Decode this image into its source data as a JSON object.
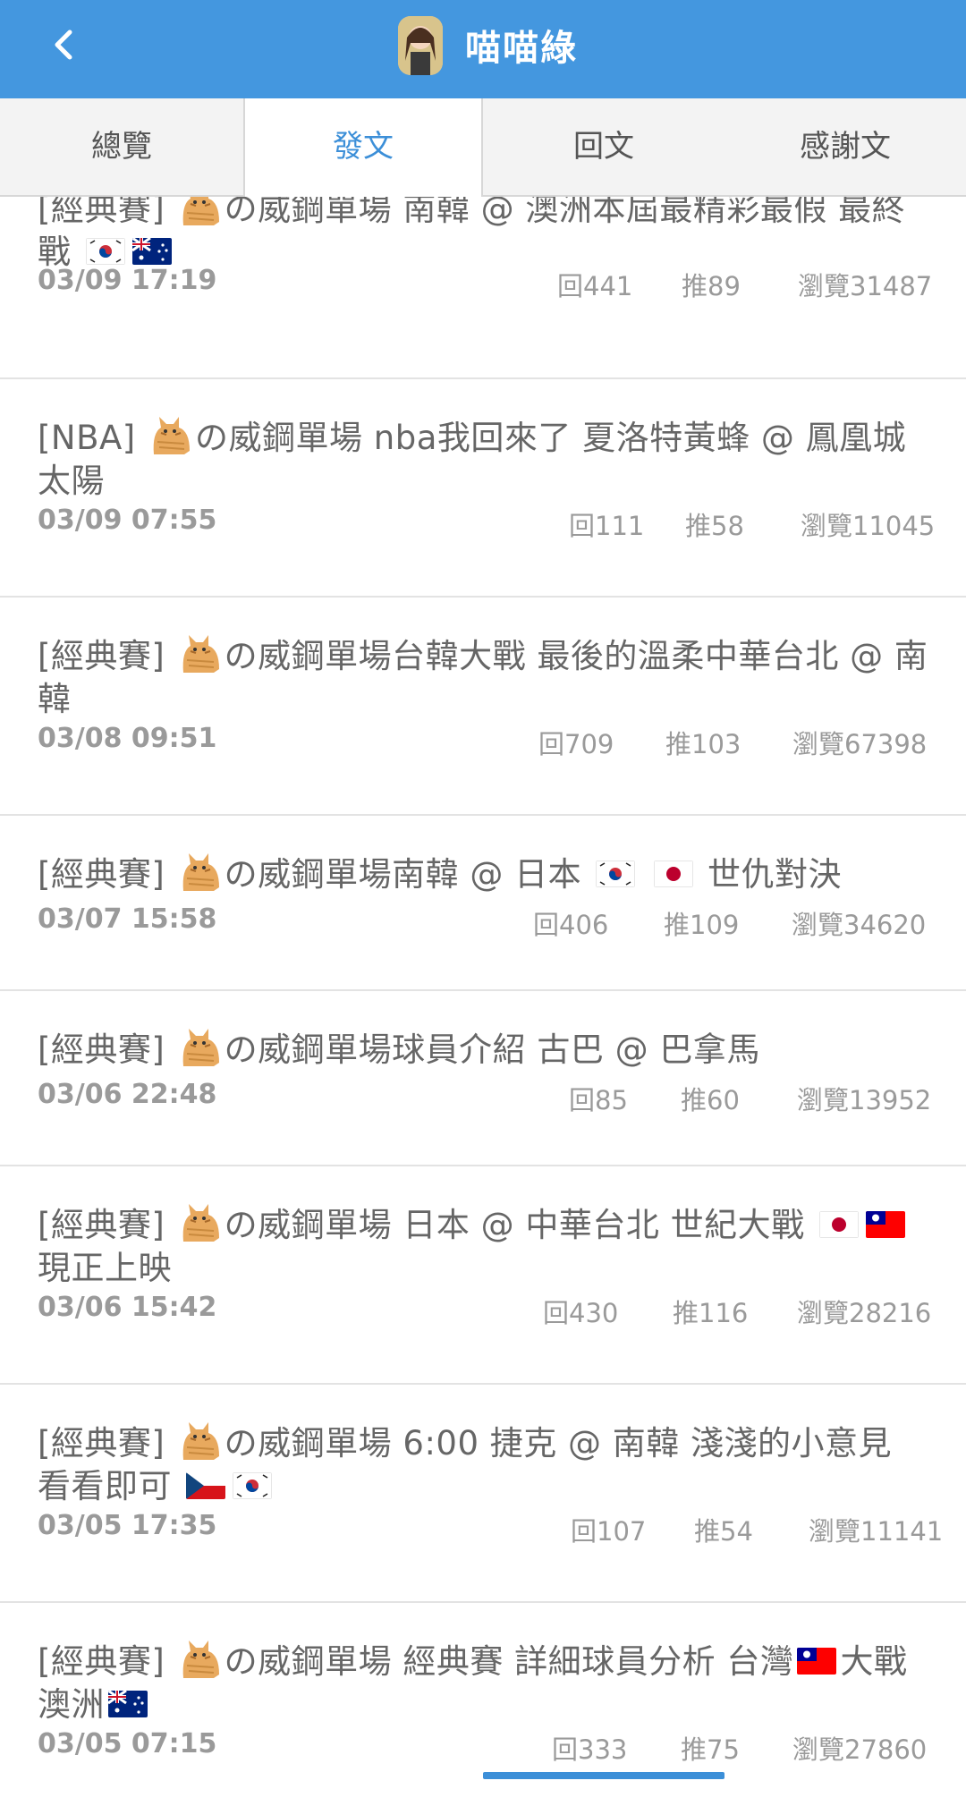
{
  "header": {
    "title": "喵喵綠",
    "accent": "#4497df"
  },
  "tabs": [
    "總覽",
    "發文",
    "回文",
    "感謝文"
  ],
  "active_tab": 1,
  "posts": [
    {
      "title_parts": [
        {
          "t": "[經典賽] "
        },
        {
          "cat": 1
        },
        {
          "t": "の威鋼單場 南韓 @ 澳洲本屆最精彩最假 最終戰 "
        },
        {
          "flag": "kr"
        },
        {
          "flag": "au"
        }
      ],
      "date": "03/09 17:19",
      "reply": "回441",
      "push": "推89",
      "view": "瀏覽31487"
    },
    {
      "title_parts": [
        {
          "t": "[NBA] "
        },
        {
          "cat": 1
        },
        {
          "t": "の威鋼單場 nba我回來了 夏洛特黃蜂 @ 鳳凰城太陽"
        }
      ],
      "date": "03/09 07:55",
      "reply": "回111",
      "push": "推58",
      "view": "瀏覽11045"
    },
    {
      "title_parts": [
        {
          "t": "[經典賽] "
        },
        {
          "cat": 1
        },
        {
          "t": "の威鋼單場台韓大戰 最後的溫柔中華台北 @ 南韓"
        }
      ],
      "date": "03/08 09:51",
      "reply": "回709",
      "push": "推103",
      "view": "瀏覽67398"
    },
    {
      "title_parts": [
        {
          "t": "[經典賽] "
        },
        {
          "cat": 1
        },
        {
          "t": "の威鋼單場南韓 @ 日本 "
        },
        {
          "flag": "kr"
        },
        {
          "t": " "
        },
        {
          "flag": "jp"
        },
        {
          "t": " 世仇對決"
        }
      ],
      "date": "03/07 15:58",
      "reply": "回406",
      "push": "推109",
      "view": "瀏覽34620"
    },
    {
      "title_parts": [
        {
          "t": "[經典賽] "
        },
        {
          "cat": 1
        },
        {
          "t": "の威鋼單場球員介紹 古巴 @ 巴拿馬"
        }
      ],
      "date": "03/06 22:48",
      "reply": "回85",
      "push": "推60",
      "view": "瀏覽13952"
    },
    {
      "title_parts": [
        {
          "t": "[經典賽] "
        },
        {
          "cat": 1
        },
        {
          "t": "の威鋼單場 日本 @ 中華台北 世紀大戰 "
        },
        {
          "flag": "jp"
        },
        {
          "flag": "tw"
        },
        {
          "t": " 現正上映"
        }
      ],
      "date": "03/06 15:42",
      "reply": "回430",
      "push": "推116",
      "view": "瀏覽28216"
    },
    {
      "title_parts": [
        {
          "t": "[經典賽] "
        },
        {
          "cat": 1
        },
        {
          "t": "の威鋼單場 6:00 捷克 @ 南韓 淺淺的小意見 看看即可 "
        },
        {
          "flag": "cz"
        },
        {
          "flag": "kr"
        }
      ],
      "date": "03/05 17:35",
      "reply": "回107",
      "push": "推54",
      "view": "瀏覽11141"
    },
    {
      "title_parts": [
        {
          "t": "[經典賽] "
        },
        {
          "cat": 1
        },
        {
          "t": "の威鋼單場 經典賽 詳細球員分析 台灣"
        },
        {
          "flag": "tw"
        },
        {
          "t": "大戰澳洲"
        },
        {
          "flag": "au"
        }
      ],
      "date": "03/05 07:15",
      "reply": "回333",
      "push": "推75",
      "view": "瀏覽27860"
    }
  ]
}
